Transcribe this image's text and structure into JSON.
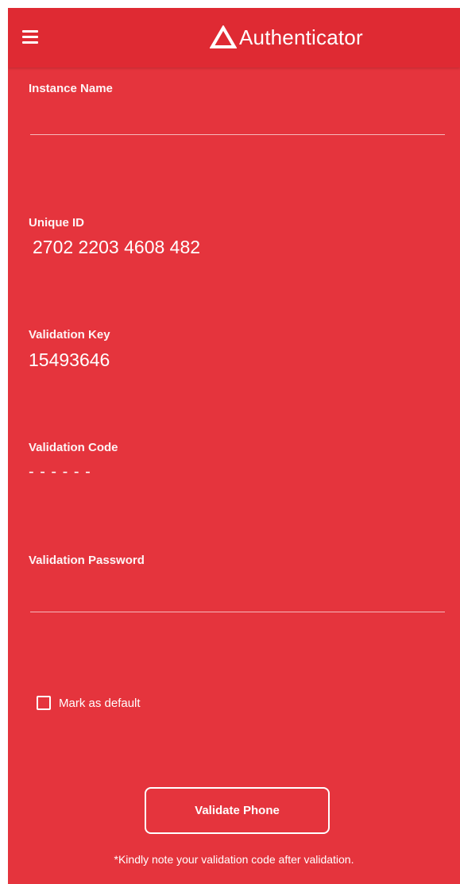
{
  "appbar": {
    "title": "Authenticator",
    "menu_icon": "hamburger-menu-icon",
    "logo_icon": "triangle-logo-icon"
  },
  "form": {
    "instance_name": {
      "label": "Instance Name",
      "value": "",
      "placeholder": ""
    },
    "unique_id": {
      "label": "Unique ID",
      "value": "2702 2203 4608 482"
    },
    "validation_key": {
      "label": "Validation Key",
      "value": "15493646"
    },
    "validation_code": {
      "label": "Validation Code",
      "value": "- - - - - -"
    },
    "validation_password": {
      "label": "Validation Password",
      "value": "",
      "placeholder": ""
    },
    "mark_default": {
      "label": "Mark as default",
      "checked": false
    },
    "validate_button": {
      "label": "Validate Phone"
    },
    "footer_note": "*Kindly note your validation code after validation."
  },
  "colors": {
    "background": "#e5343d",
    "appbar": "#df2a33",
    "text": "#ffffff"
  }
}
